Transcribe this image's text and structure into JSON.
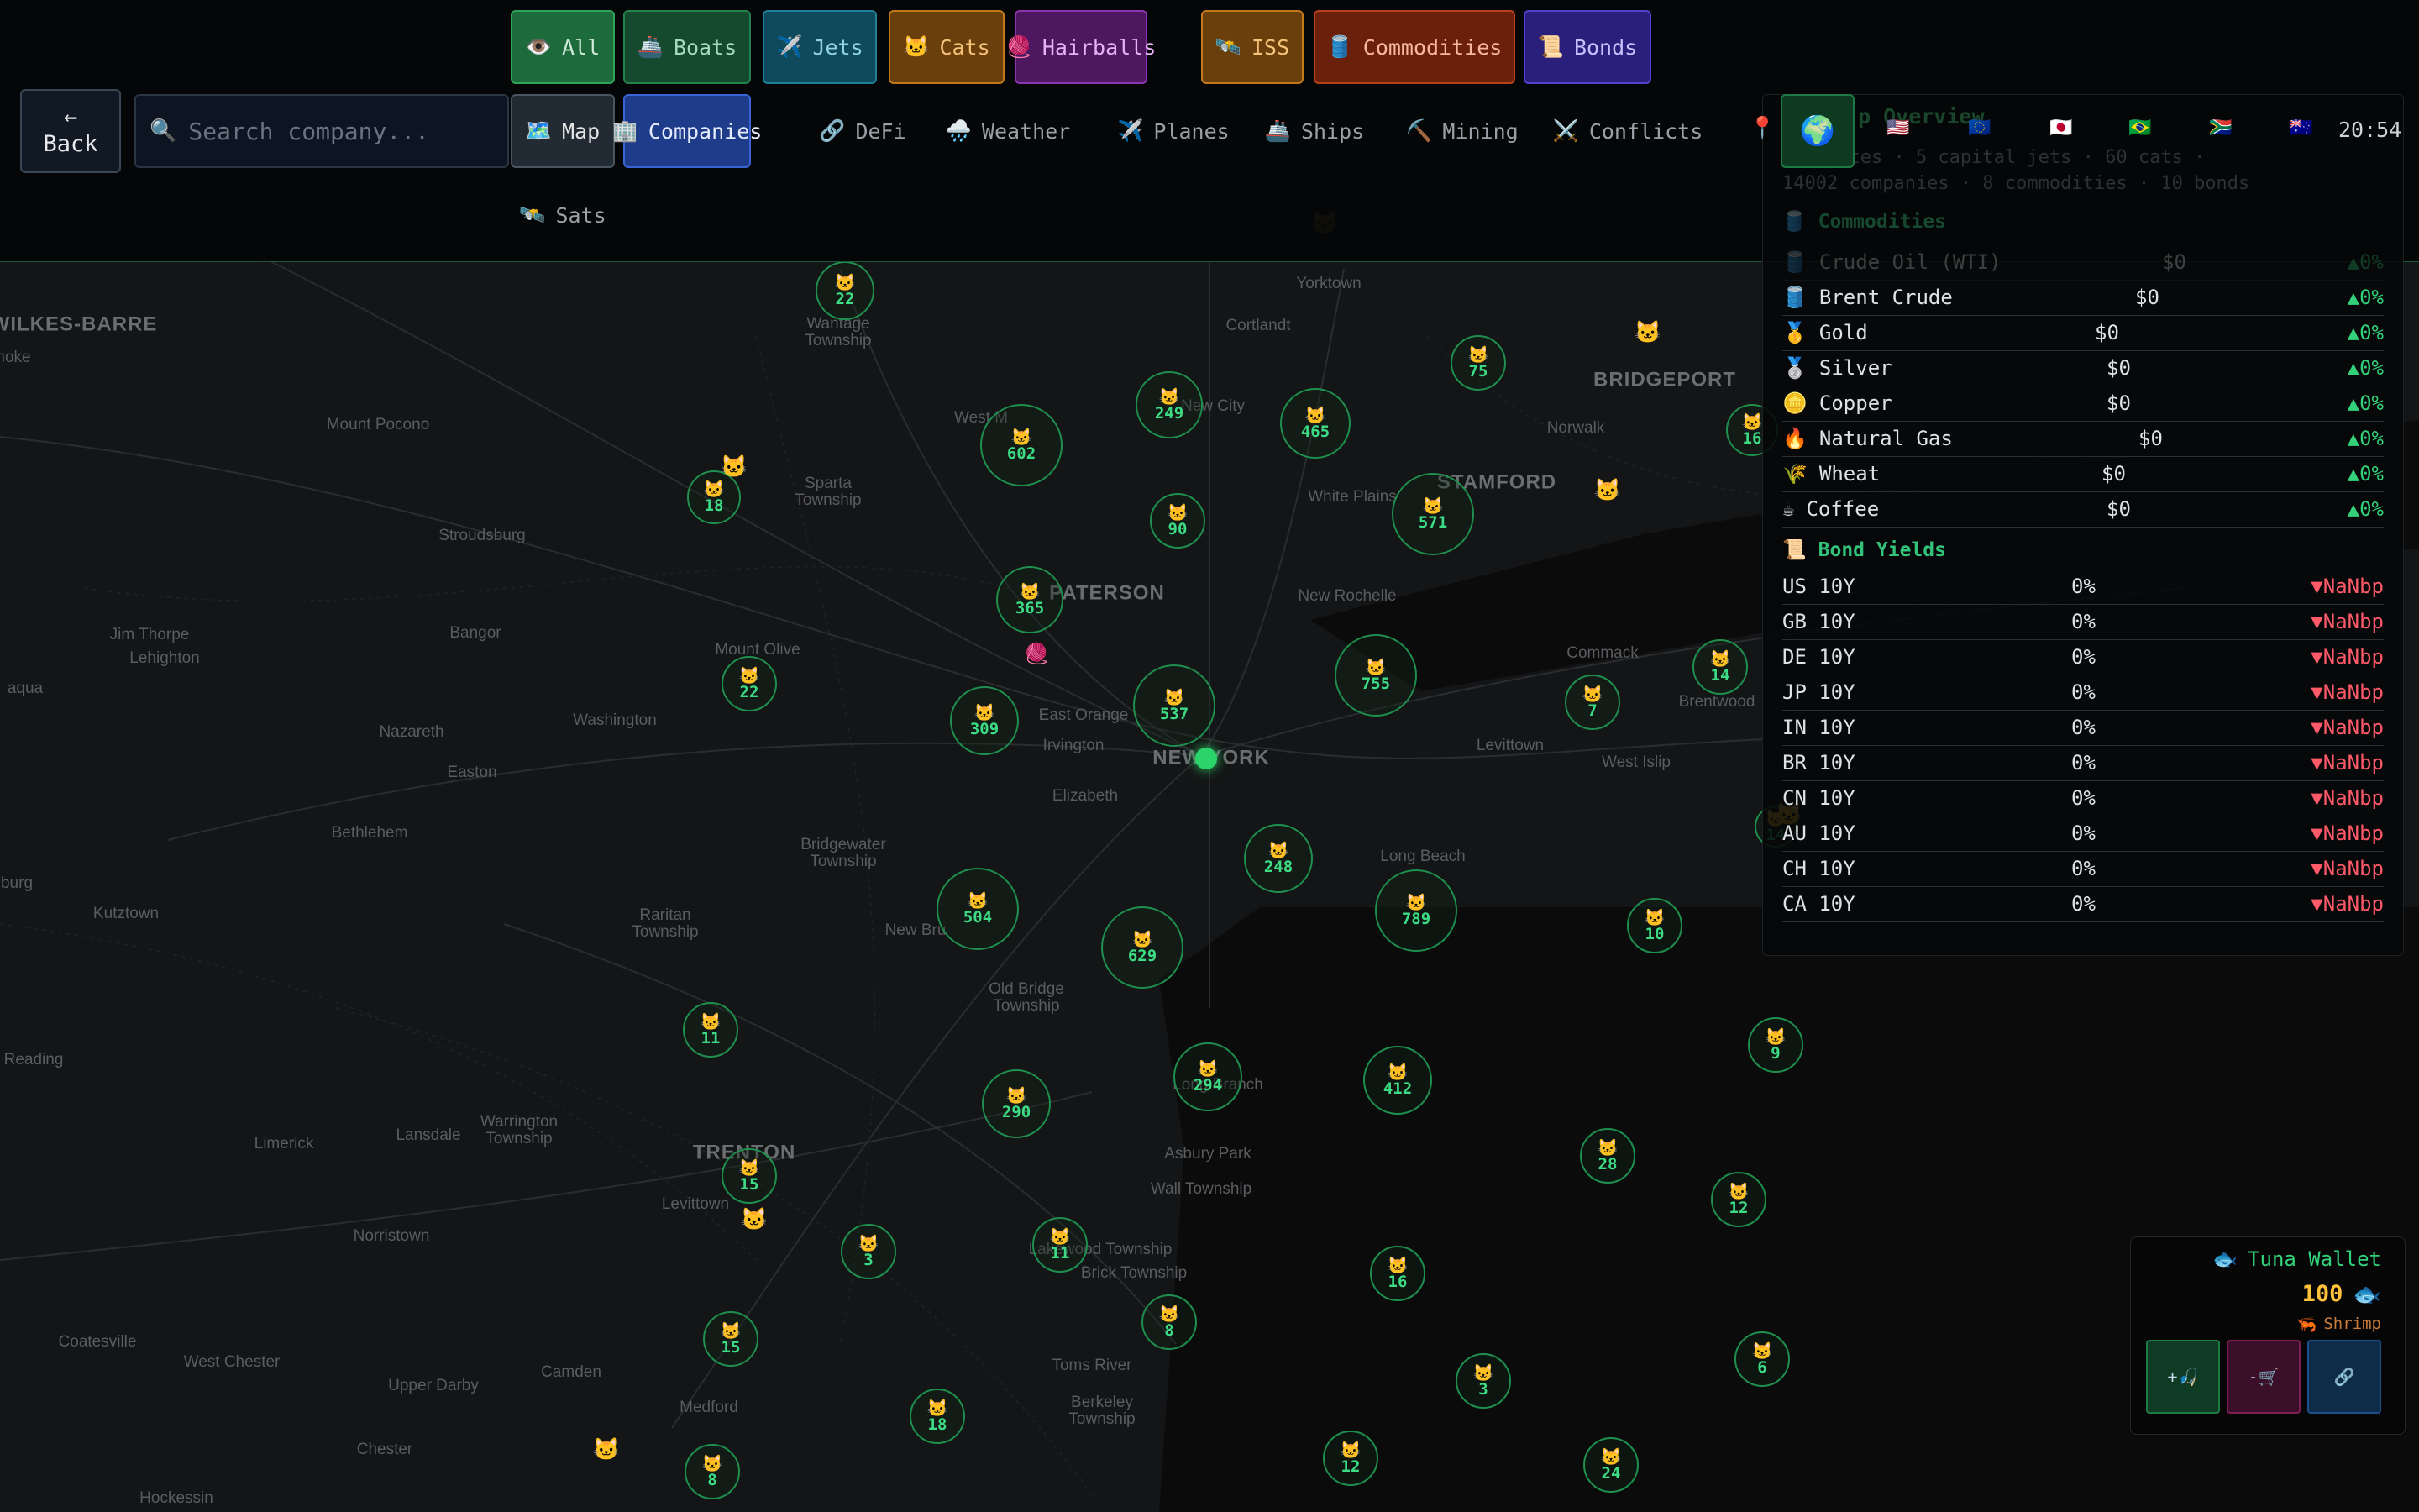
{
  "filters": [
    {
      "label": "All",
      "icon": "👁️",
      "color": "#1d6b3a",
      "border": "#2fa35a",
      "text": "#cfe9d8"
    },
    {
      "label": "Boats",
      "icon": "🚢",
      "color": "#154a2e",
      "border": "#23814a",
      "text": "#a6dcbc"
    },
    {
      "label": "Jets",
      "icon": "✈️",
      "color": "#0f4a5c",
      "border": "#1f7f99",
      "text": "#8fd3e6"
    },
    {
      "label": "Cats",
      "icon": "🐱",
      "color": "#6a3f0c",
      "border": "#c17a1a",
      "text": "#f5c27a"
    },
    {
      "label": "Hairballs",
      "icon": "🧶",
      "color": "#4d1860",
      "border": "#8d33b0",
      "text": "#e6b3f7"
    },
    {
      "label": "ISS",
      "icon": "🛰️",
      "color": "#6a3f0c",
      "border": "#c17a1a",
      "text": "#f5c27a"
    },
    {
      "label": "Commodities",
      "icon": "🛢️",
      "color": "#6b200c",
      "border": "#b6421c",
      "text": "#f8b8a0"
    },
    {
      "label": "Bonds",
      "icon": "📜",
      "color": "#2a1f7a",
      "border": "#5342d0",
      "text": "#c9c0ff"
    }
  ],
  "nav": {
    "back_arrow": "←",
    "back_label": "Back",
    "search_icon": "🔍",
    "search_placeholder": "Search company...",
    "items": [
      {
        "label": "Map",
        "icon": "🗺️"
      },
      {
        "label": "Companies",
        "icon": "🏢"
      },
      {
        "label": "DeFi",
        "icon": "🔗"
      },
      {
        "label": "Weather",
        "icon": "🌧️"
      },
      {
        "label": "Planes",
        "icon": "✈️"
      },
      {
        "label": "Ships",
        "icon": "🚢"
      },
      {
        "label": "Mining",
        "icon": "⛏️"
      },
      {
        "label": "Conflicts",
        "icon": "⚔️"
      },
      {
        "label": "Sats",
        "icon": "🛰️"
      }
    ],
    "pin_icon": "📍",
    "globe_icon": "🌍",
    "flags": [
      "🇺🇸",
      "🇪🇺",
      "🇯🇵",
      "🇧🇷",
      "🇿🇦",
      "🇦🇺"
    ],
    "clock": "20:54"
  },
  "overview": {
    "title": "p Overview",
    "subtitle_line1": "de routes · 5 capital jets · 60 cats ·",
    "subtitle_line2": "14002 companies · 8 commodities · 10 bonds",
    "commodities_header": "Commodities",
    "commodities_icon": "🛢️",
    "commodities": [
      {
        "icon": "🛢️",
        "name": "Crude Oil (WTI)",
        "price": "$0",
        "change": "▲0%"
      },
      {
        "icon": "🛢️",
        "name": "Brent Crude",
        "price": "$0",
        "change": "▲0%"
      },
      {
        "icon": "🥇",
        "name": "Gold",
        "price": "$0",
        "change": "▲0%"
      },
      {
        "icon": "🥈",
        "name": "Silver",
        "price": "$0",
        "change": "▲0%"
      },
      {
        "icon": "🪙",
        "name": "Copper",
        "price": "$0",
        "change": "▲0%"
      },
      {
        "icon": "🔥",
        "name": "Natural Gas",
        "price": "$0",
        "change": "▲0%"
      },
      {
        "icon": "🌾",
        "name": "Wheat",
        "price": "$0",
        "change": "▲0%"
      },
      {
        "icon": "☕",
        "name": "Coffee",
        "price": "$0",
        "change": "▲0%"
      }
    ],
    "bonds_header": "Bond Yields",
    "bonds_icon": "📜",
    "bonds": [
      {
        "name": "US 10Y",
        "yield": "0%",
        "change": "▼NaNbp"
      },
      {
        "name": "GB 10Y",
        "yield": "0%",
        "change": "▼NaNbp"
      },
      {
        "name": "DE 10Y",
        "yield": "0%",
        "change": "▼NaNbp"
      },
      {
        "name": "JP 10Y",
        "yield": "0%",
        "change": "▼NaNbp"
      },
      {
        "name": "IN 10Y",
        "yield": "0%",
        "change": "▼NaNbp"
      },
      {
        "name": "BR 10Y",
        "yield": "0%",
        "change": "▼NaNbp"
      },
      {
        "name": "CN 10Y",
        "yield": "0%",
        "change": "▼NaNbp"
      },
      {
        "name": "AU 10Y",
        "yield": "0%",
        "change": "▼NaNbp"
      },
      {
        "name": "CH 10Y",
        "yield": "0%",
        "change": "▼NaNbp"
      },
      {
        "name": "CA 10Y",
        "yield": "0%",
        "change": "▼NaNbp"
      }
    ]
  },
  "wallet": {
    "icon": "🐟",
    "title": "Tuna Wallet",
    "amount": "100",
    "amount_icon": "🐟",
    "rank_icon": "🦐",
    "rank": "Shrimp",
    "buttons": [
      {
        "label": "+🎣",
        "color": "#0f3b24",
        "border": "#1f7a44"
      },
      {
        "label": "-🛒",
        "color": "#3b0f2a",
        "border": "#7a1f55"
      },
      {
        "label": "🔗",
        "color": "#0f2b4a",
        "border": "#1f4f8a"
      }
    ]
  },
  "map": {
    "cluster_icon": "🐱",
    "cat_icon": "🐱",
    "hairball_icon": "🧶",
    "places": [
      {
        "name": "WILKES-BARRE",
        "big": true
      },
      {
        "name": "Wantage\nTownship"
      },
      {
        "name": "Yorktown"
      },
      {
        "name": "Cortlandt"
      },
      {
        "name": "BRIDGEPORT",
        "big": true
      },
      {
        "name": "Mount Pocono"
      },
      {
        "name": "West M"
      },
      {
        "name": "New City"
      },
      {
        "name": "Norwalk"
      },
      {
        "name": "Sparta\nTownship"
      },
      {
        "name": "White Plains"
      },
      {
        "name": "STAMFORD",
        "big": true
      },
      {
        "name": "Stroudsburg"
      },
      {
        "name": "PATERSON",
        "big": true
      },
      {
        "name": "New Rochelle"
      },
      {
        "name": "Bangor"
      },
      {
        "name": "Jim Thorpe"
      },
      {
        "name": "Lehighton"
      },
      {
        "name": "Mount Olive"
      },
      {
        "name": "Commack"
      },
      {
        "name": "Washington"
      },
      {
        "name": "East Orange"
      },
      {
        "name": "Nazareth"
      },
      {
        "name": "Irvington"
      },
      {
        "name": "NEW YORK",
        "big": true
      },
      {
        "name": "Brentwood"
      },
      {
        "name": "Levittown"
      },
      {
        "name": "Easton"
      },
      {
        "name": "West Islip"
      },
      {
        "name": "Elizabeth"
      },
      {
        "name": "Bethlehem"
      },
      {
        "name": "Bridgewater\nTownship"
      },
      {
        "name": "Long Beach"
      },
      {
        "name": "Kutztown"
      },
      {
        "name": "Raritan\nTownship"
      },
      {
        "name": "New Bru"
      },
      {
        "name": "Old Bridge\nTownship"
      },
      {
        "name": "Reading"
      },
      {
        "name": "Long Branch"
      },
      {
        "name": "Warrington\nTownship"
      },
      {
        "name": "Limerick"
      },
      {
        "name": "Lansdale"
      },
      {
        "name": "TRENTON",
        "big": true
      },
      {
        "name": "Asbury Park"
      },
      {
        "name": "Wall Township"
      },
      {
        "name": "Levittown"
      },
      {
        "name": "Norristown"
      },
      {
        "name": "Lakewood Township"
      },
      {
        "name": "Brick Township"
      },
      {
        "name": "Coatesville"
      },
      {
        "name": "West Chester"
      },
      {
        "name": "Camden"
      },
      {
        "name": "Toms River"
      },
      {
        "name": "Upper Darby"
      },
      {
        "name": "Berkeley\nTownship"
      },
      {
        "name": "Medford"
      },
      {
        "name": "Chester"
      },
      {
        "name": "Hockessin"
      },
      {
        "name": "aqua"
      },
      {
        "name": "burg"
      },
      {
        "name": "hoke"
      }
    ],
    "clusters": [
      22,
      18,
      602,
      249,
      465,
      75,
      16,
      90,
      571,
      365,
      22,
      309,
      537,
      755,
      7,
      14,
      14,
      504,
      629,
      248,
      789,
      10,
      11,
      290,
      294,
      412,
      9,
      15,
      28,
      12,
      3,
      11,
      16,
      8,
      15,
      3,
      6,
      18,
      12,
      24,
      8
    ],
    "lone_cats": 8,
    "hairballs": 1
  }
}
